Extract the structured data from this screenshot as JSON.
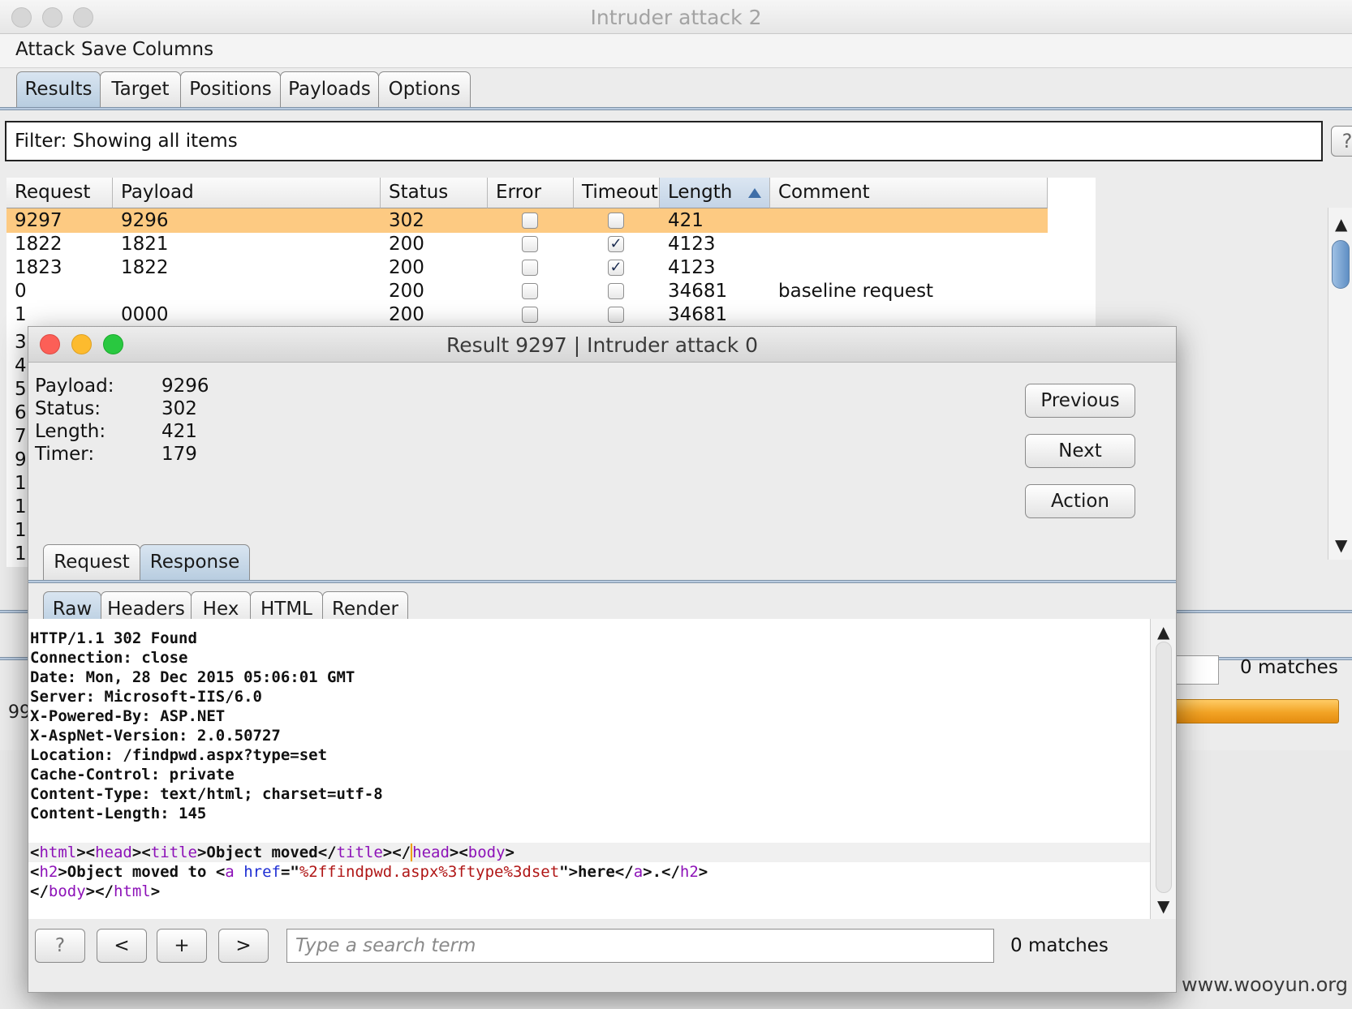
{
  "main_window": {
    "title": "Intruder attack 2",
    "menu": [
      "Attack",
      "Save",
      "Columns"
    ],
    "tabs": [
      "Results",
      "Target",
      "Positions",
      "Payloads",
      "Options"
    ],
    "active_tab": "Results",
    "filter": "Filter: Showing all items",
    "filter_help": "?",
    "table": {
      "columns": [
        "Request",
        "Payload",
        "Status",
        "Error",
        "Timeout",
        "Length",
        "Comment"
      ],
      "sorted_column": "Length",
      "rows": [
        {
          "request": "9297",
          "payload": "9296",
          "status": "302",
          "error": false,
          "timeout": false,
          "length": "421",
          "comment": "",
          "selected": true
        },
        {
          "request": "1822",
          "payload": "1821",
          "status": "200",
          "error": false,
          "timeout": true,
          "length": "4123",
          "comment": ""
        },
        {
          "request": "1823",
          "payload": "1822",
          "status": "200",
          "error": false,
          "timeout": true,
          "length": "4123",
          "comment": ""
        },
        {
          "request": "0",
          "payload": "",
          "status": "200",
          "error": false,
          "timeout": false,
          "length": "34681",
          "comment": "baseline request"
        },
        {
          "request": "1",
          "payload": "0000",
          "status": "200",
          "error": false,
          "timeout": false,
          "length": "34681",
          "comment": ""
        }
      ],
      "partial_row_numbers": [
        "3",
        "4",
        "5",
        "6",
        "7",
        "9",
        "1",
        "1",
        "1",
        "1"
      ]
    },
    "scroll_up": "▲",
    "scroll_down": "▼",
    "background_matches": "0 matches",
    "background_count_partial": "99",
    "progress_color": "#f2a325"
  },
  "result_window": {
    "title": "Result 9297 | Intruder attack 0",
    "info": [
      {
        "label": "Payload:",
        "value": "9296"
      },
      {
        "label": "Status:",
        "value": "302"
      },
      {
        "label": "Length:",
        "value": "421"
      },
      {
        "label": "Timer:",
        "value": "179"
      }
    ],
    "buttons": {
      "previous": "Previous",
      "next": "Next",
      "action": "Action"
    },
    "tabs": [
      "Request",
      "Response"
    ],
    "active_tab": "Response",
    "subtabs": [
      "Raw",
      "Headers",
      "Hex",
      "HTML",
      "Render"
    ],
    "active_subtab": "Raw",
    "response_headers": [
      "HTTP/1.1 302 Found",
      "Connection: close",
      "Date: Mon, 28 Dec 2015 05:06:01 GMT",
      "Server: Microsoft-IIS/6.0",
      "X-Powered-By: ASP.NET",
      "X-AspNet-Version: 2.0.50727",
      "Location: /findpwd.aspx?type=set",
      "Cache-Control: private",
      "Content-Type: text/html; charset=utf-8",
      "Content-Length: 145"
    ],
    "body_text": {
      "title_text": "Object moved",
      "h2_text": "Object moved to ",
      "href_value": "%2ffindpwd.aspx%3ftype%3dset",
      "link_text": "here"
    },
    "scroll_up": "▲",
    "scroll_down": "▼",
    "search": {
      "help": "?",
      "prev": "<",
      "add": "+",
      "next": ">",
      "placeholder": "Type a search term",
      "matches": "0 matches"
    }
  },
  "watermark": "www.wooyun.org",
  "colors": {
    "selected_row": "#fdca82",
    "tag": "#8d12b8",
    "attribute": "#1f2fd4",
    "string": "#b01616",
    "tab_active": "#b8cde0"
  }
}
